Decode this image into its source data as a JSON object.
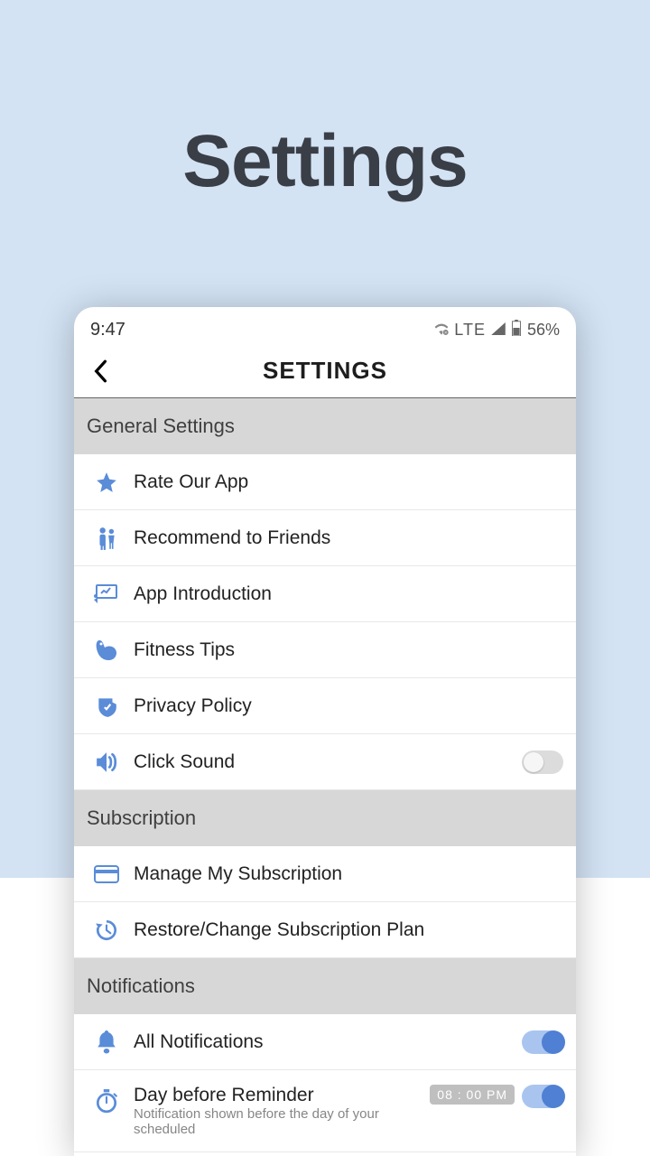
{
  "hero": {
    "title": "Settings"
  },
  "status": {
    "time": "9:47",
    "carrier": "LTE",
    "battery": "56%"
  },
  "appbar": {
    "title": "SETTINGS"
  },
  "sections": {
    "general": {
      "header": "General Settings",
      "rate": "Rate Our App",
      "recommend": "Recommend to Friends",
      "intro": "App Introduction",
      "fitness": "Fitness Tips",
      "privacy": "Privacy Policy",
      "click": "Click Sound"
    },
    "subscription": {
      "header": "Subscription",
      "manage": "Manage My Subscription",
      "restore": "Restore/Change Subscription Plan"
    },
    "notifications": {
      "header": "Notifications",
      "all": "All Notifications",
      "daybefore_title": "Day before Reminder",
      "daybefore_sub": "Notification shown before the day of your scheduled",
      "daybefore_time": "08 : 00 PM"
    }
  }
}
